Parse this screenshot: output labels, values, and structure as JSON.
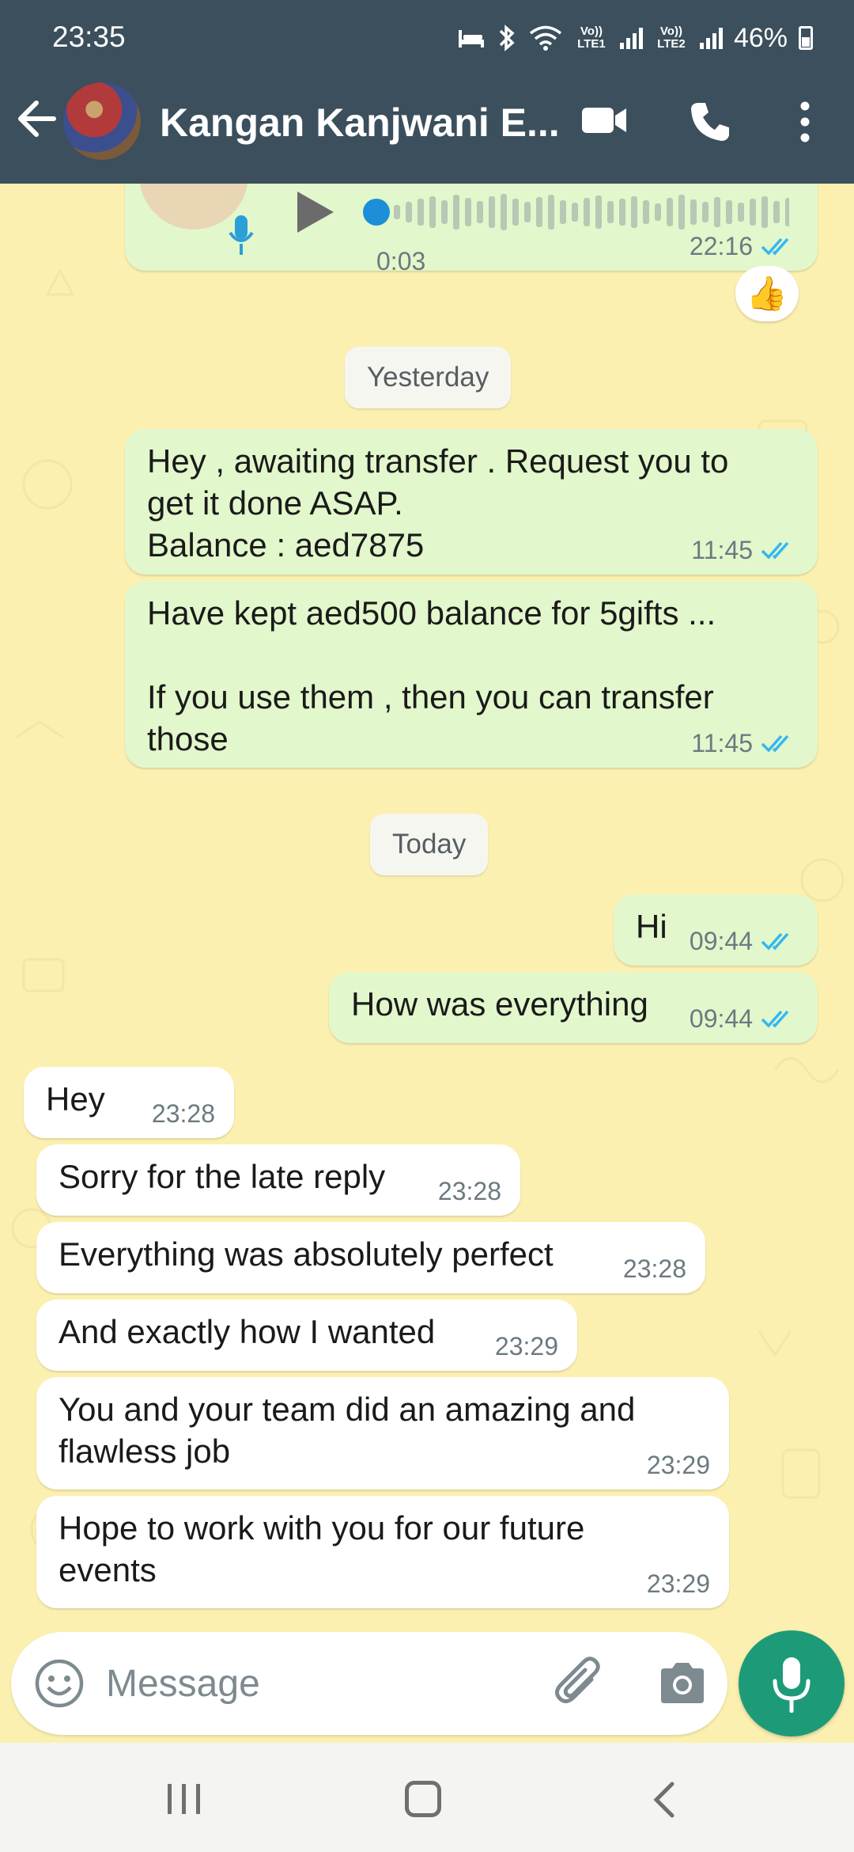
{
  "status_bar": {
    "time": "23:35",
    "sim1_label": "Vo)) LTE1",
    "sim2_label": "Vo)) LTE2",
    "battery": "46%"
  },
  "header": {
    "contact_name": "Kangan Kanjwani E...",
    "back_icon": "arrow-left-icon",
    "video_icon": "video-camera-icon",
    "call_icon": "phone-icon",
    "menu_icon": "more-vert-icon"
  },
  "voice_note": {
    "duration": "0:03",
    "time": "22:16",
    "reaction": "👍"
  },
  "date_chips": {
    "yesterday": "Yesterday",
    "today": "Today"
  },
  "messages": [
    {
      "dir": "out",
      "lines": "Hey , awaiting transfer . Request you to\nget it done ASAP.\nBalance : aed7875",
      "time": "11:45"
    },
    {
      "dir": "out",
      "lines": "Have kept aed500 balance for 5gifts ...\n\nIf you use them , then you can transfer\nthose",
      "time": "11:45"
    },
    {
      "dir": "out",
      "lines": "Hi",
      "time": "09:44"
    },
    {
      "dir": "out",
      "lines": "How was everything",
      "time": "09:44"
    },
    {
      "dir": "in",
      "lines": "Hey",
      "time": "23:28"
    },
    {
      "dir": "in",
      "lines": "Sorry for the late reply",
      "time": "23:28"
    },
    {
      "dir": "in",
      "lines": "Everything was absolutely perfect",
      "time": "23:28"
    },
    {
      "dir": "in",
      "lines": "And exactly how I wanted",
      "time": "23:29"
    },
    {
      "dir": "in",
      "lines": "You and your team did an amazing and\nflawless job",
      "time": "23:29"
    },
    {
      "dir": "in",
      "lines": "Hope to work with you for our future\nevents",
      "time": "23:29"
    }
  ],
  "composer": {
    "placeholder": "Message"
  },
  "colors": {
    "header": "#3b4f5c",
    "wallpaper": "#fcf0b1",
    "outgoing_bubble": "#e2f7cb",
    "incoming_bubble": "#ffffff",
    "read_ticks": "#34b7f1",
    "mic_button": "#1d9b78"
  }
}
